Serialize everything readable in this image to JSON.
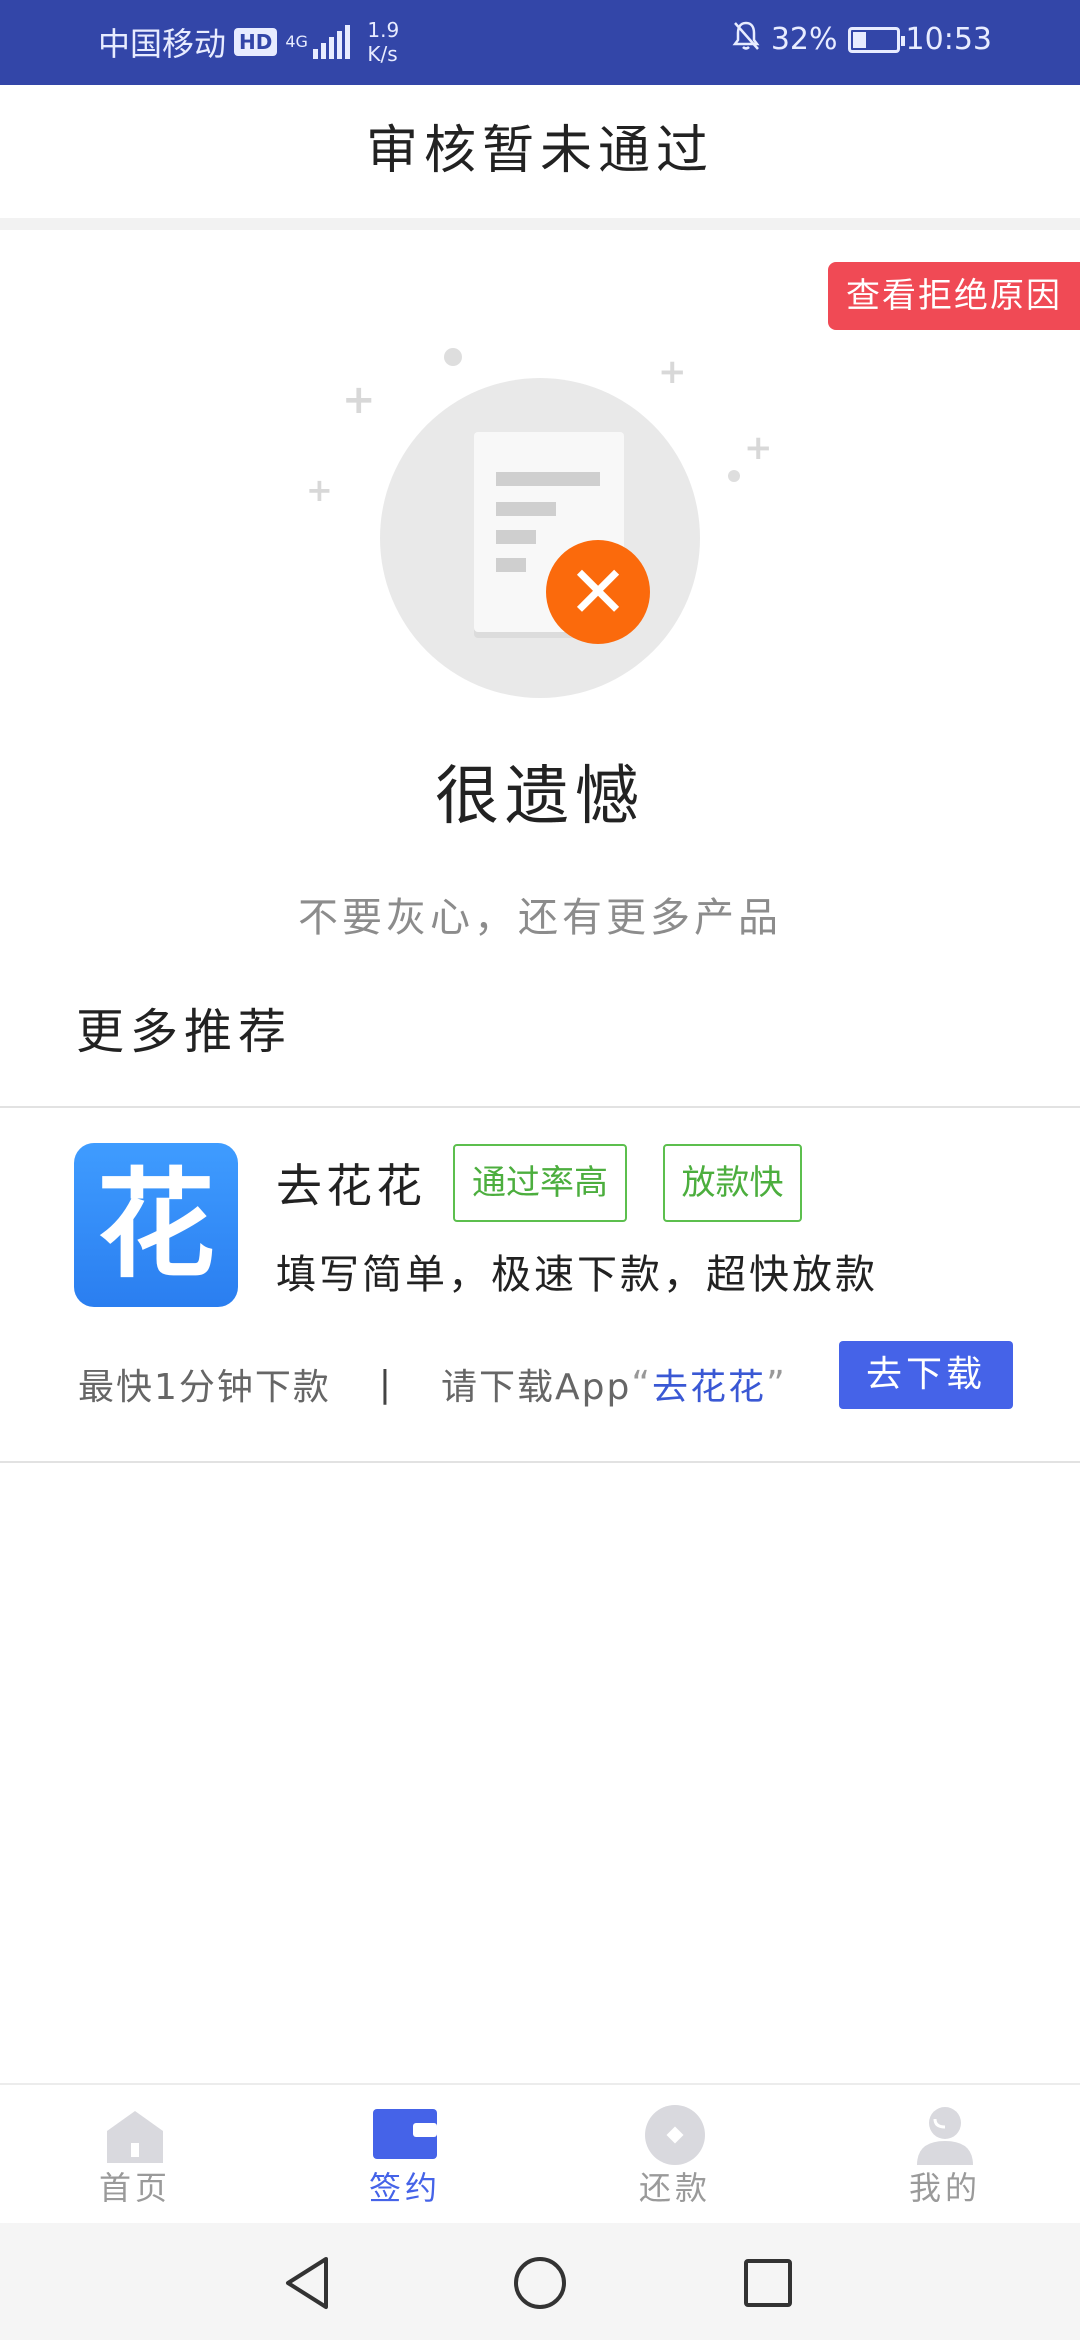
{
  "status_bar": {
    "carrier": "中国移动",
    "hd": "HD",
    "network": "4G",
    "speed_value": "1.9",
    "speed_unit": "K/s",
    "battery": "32%",
    "battery_level": 0.32,
    "time": "10:53"
  },
  "header": {
    "title": "审核暂未通过"
  },
  "reject_button": {
    "label": "查看拒绝原因"
  },
  "result": {
    "title": "很遗憾",
    "subtitle": "不要灰心，还有更多产品"
  },
  "recommend": {
    "section_title": "更多推荐",
    "items": [
      {
        "logo_char": "花",
        "name": "去花花",
        "tags": [
          "通过率高",
          "放款快"
        ],
        "description": "填写简单，极速下款，超快放款",
        "speed_text": "最快1分钟下款",
        "separator": "|",
        "download_prompt": "请下载App",
        "quote_open": "“",
        "app_link": "去花花",
        "quote_close": "”",
        "button_label": "去下载"
      }
    ]
  },
  "bottom_nav": {
    "items": [
      {
        "label": "首页",
        "icon": "home-icon"
      },
      {
        "label": "签约",
        "icon": "wallet-icon"
      },
      {
        "label": "还款",
        "icon": "coin-icon"
      },
      {
        "label": "我的",
        "icon": "user-icon"
      }
    ],
    "active_index": 1
  },
  "colors": {
    "status_bar": "#3346a8",
    "accent": "#4563e8",
    "reject": "#f04a55",
    "tag_green": "#4cae3e",
    "error_orange": "#fb6a0c"
  }
}
